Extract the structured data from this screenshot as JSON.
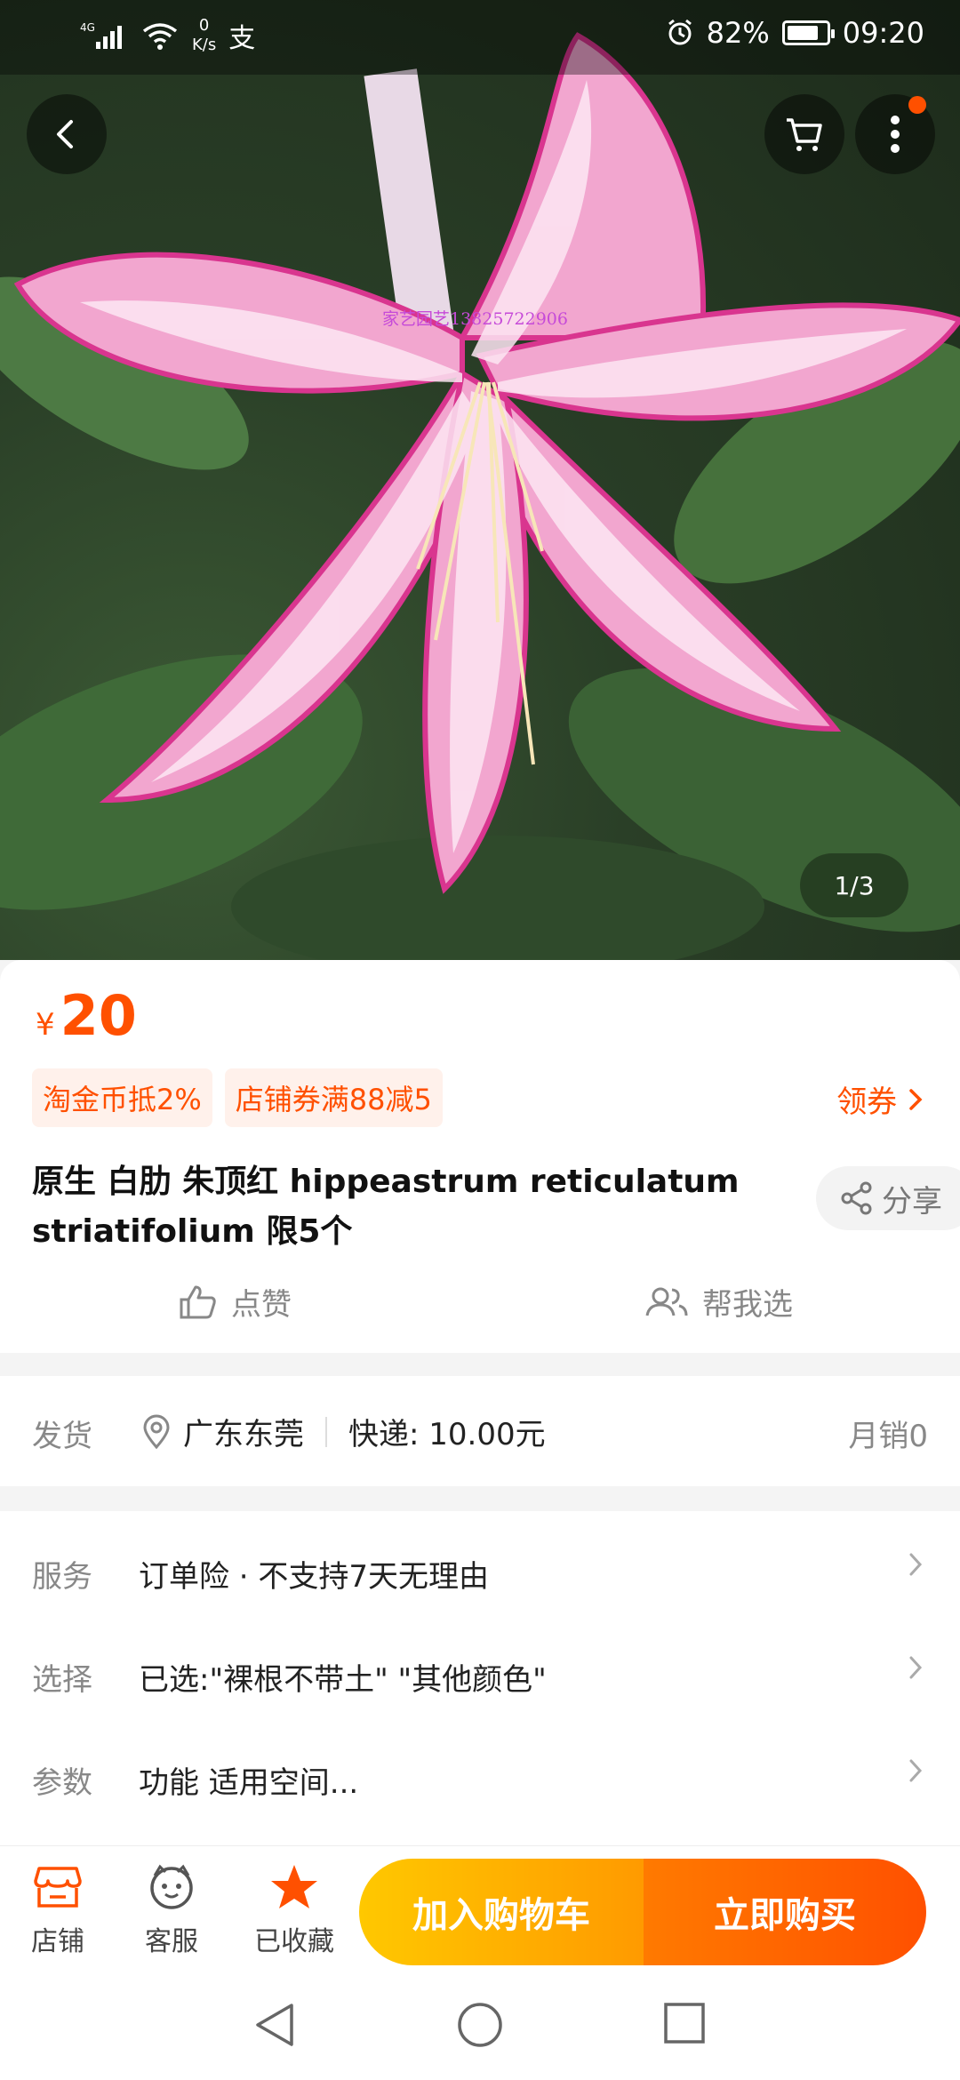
{
  "status_bar": {
    "network": "4G",
    "net_speed_value": "0",
    "net_speed_unit": "K/s",
    "pay_glyph": "支",
    "battery": "82%",
    "battery_level": 0.82,
    "time": "09:20"
  },
  "hero": {
    "watermark": "家艺园艺13825722906",
    "pager": "1/3"
  },
  "product": {
    "currency": "¥",
    "price": "20",
    "tags": [
      "淘金币抵2%",
      "店铺券满88减5"
    ],
    "coupon_link": "领券",
    "title": "原生 白肋 朱顶红 hippeastrum reticulatum striatifolium 限5个",
    "share_label": "分享",
    "like_label": "点赞",
    "help_label": "帮我选"
  },
  "shipping": {
    "label": "发货",
    "location": "广东东莞",
    "express": "快递: 10.00元",
    "sales": "月销0"
  },
  "info_rows": [
    {
      "key": "服务",
      "value": "订单险 · 不支持7天无理由"
    },
    {
      "key": "选择",
      "value": "已选:\"裸根不带土\" \"其他颜色\""
    },
    {
      "key": "参数",
      "value": "功能 适用空间..."
    }
  ],
  "bottom_bar": {
    "store": "店铺",
    "service": "客服",
    "favorited": "已收藏",
    "add_to_cart": "加入购物车",
    "buy_now": "立即购买"
  },
  "colors": {
    "accent": "#ff5000",
    "cart_gradient": [
      "#ffc800",
      "#ff9a00"
    ],
    "buy_gradient": [
      "#ff7a00",
      "#ff5000"
    ]
  }
}
